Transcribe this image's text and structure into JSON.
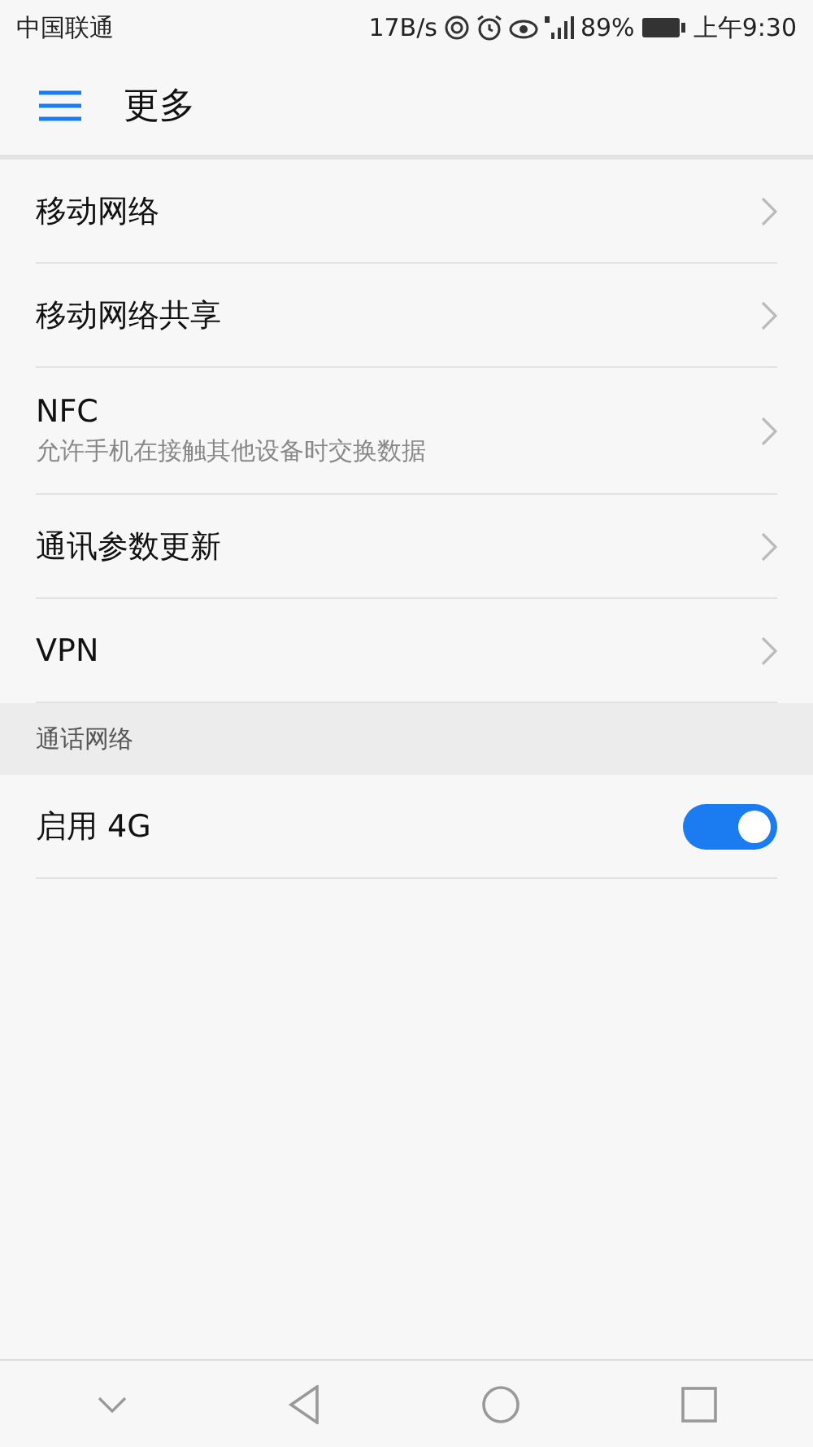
{
  "status_bar": {
    "carrier": "中国联通",
    "speed": "17B/s",
    "battery": "89%",
    "time": "上午9:30"
  },
  "header": {
    "title": "更多"
  },
  "items": [
    {
      "title": "移动网络"
    },
    {
      "title": "移动网络共享"
    },
    {
      "title": "NFC",
      "subtitle": "允许手机在接触其他设备时交换数据"
    },
    {
      "title": "通讯参数更新"
    },
    {
      "title": "VPN"
    }
  ],
  "section": {
    "title": "通话网络",
    "items": [
      {
        "title": "启用 4G",
        "on": true
      }
    ]
  }
}
